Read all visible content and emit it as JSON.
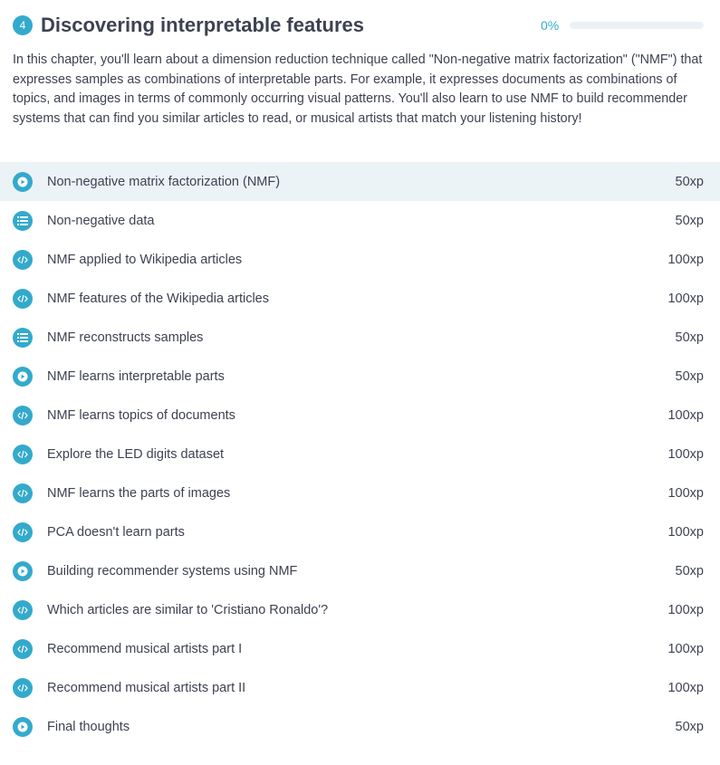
{
  "chapter": {
    "number": "4",
    "title": "Discovering interpretable features",
    "progress_label": "0%",
    "progress": 0,
    "description": "In this chapter, you'll learn about a dimension reduction technique called \"Non-negative matrix factorization\" (\"NMF\") that expresses samples as combinations of interpretable parts. For example, it expresses documents as combinations of topics, and images in terms of commonly occurring visual patterns. You'll also learn to use NMF to build recommender systems that can find you similar articles to read, or musical artists that match your listening history!"
  },
  "exercises": [
    {
      "type": "video",
      "label": "Non-negative matrix factorization (NMF)",
      "xp": "50xp"
    },
    {
      "type": "multiple-choice",
      "label": "Non-negative data",
      "xp": "50xp"
    },
    {
      "type": "code",
      "label": "NMF applied to Wikipedia articles",
      "xp": "100xp"
    },
    {
      "type": "code",
      "label": "NMF features of the Wikipedia articles",
      "xp": "100xp"
    },
    {
      "type": "multiple-choice",
      "label": "NMF reconstructs samples",
      "xp": "50xp"
    },
    {
      "type": "video",
      "label": "NMF learns interpretable parts",
      "xp": "50xp"
    },
    {
      "type": "code",
      "label": "NMF learns topics of documents",
      "xp": "100xp"
    },
    {
      "type": "code",
      "label": "Explore the LED digits dataset",
      "xp": "100xp"
    },
    {
      "type": "code",
      "label": "NMF learns the parts of images",
      "xp": "100xp"
    },
    {
      "type": "code",
      "label": "PCA doesn't learn parts",
      "xp": "100xp"
    },
    {
      "type": "video",
      "label": "Building recommender systems using NMF",
      "xp": "50xp"
    },
    {
      "type": "code",
      "label": "Which articles are similar to 'Cristiano Ronaldo'?",
      "xp": "100xp"
    },
    {
      "type": "code",
      "label": "Recommend musical artists part I",
      "xp": "100xp"
    },
    {
      "type": "code",
      "label": "Recommend musical artists part II",
      "xp": "100xp"
    },
    {
      "type": "video",
      "label": "Final thoughts",
      "xp": "50xp"
    }
  ],
  "colors": {
    "accent": "#33aacc",
    "text": "#3d4251",
    "active_row": "#ebf3f7"
  }
}
